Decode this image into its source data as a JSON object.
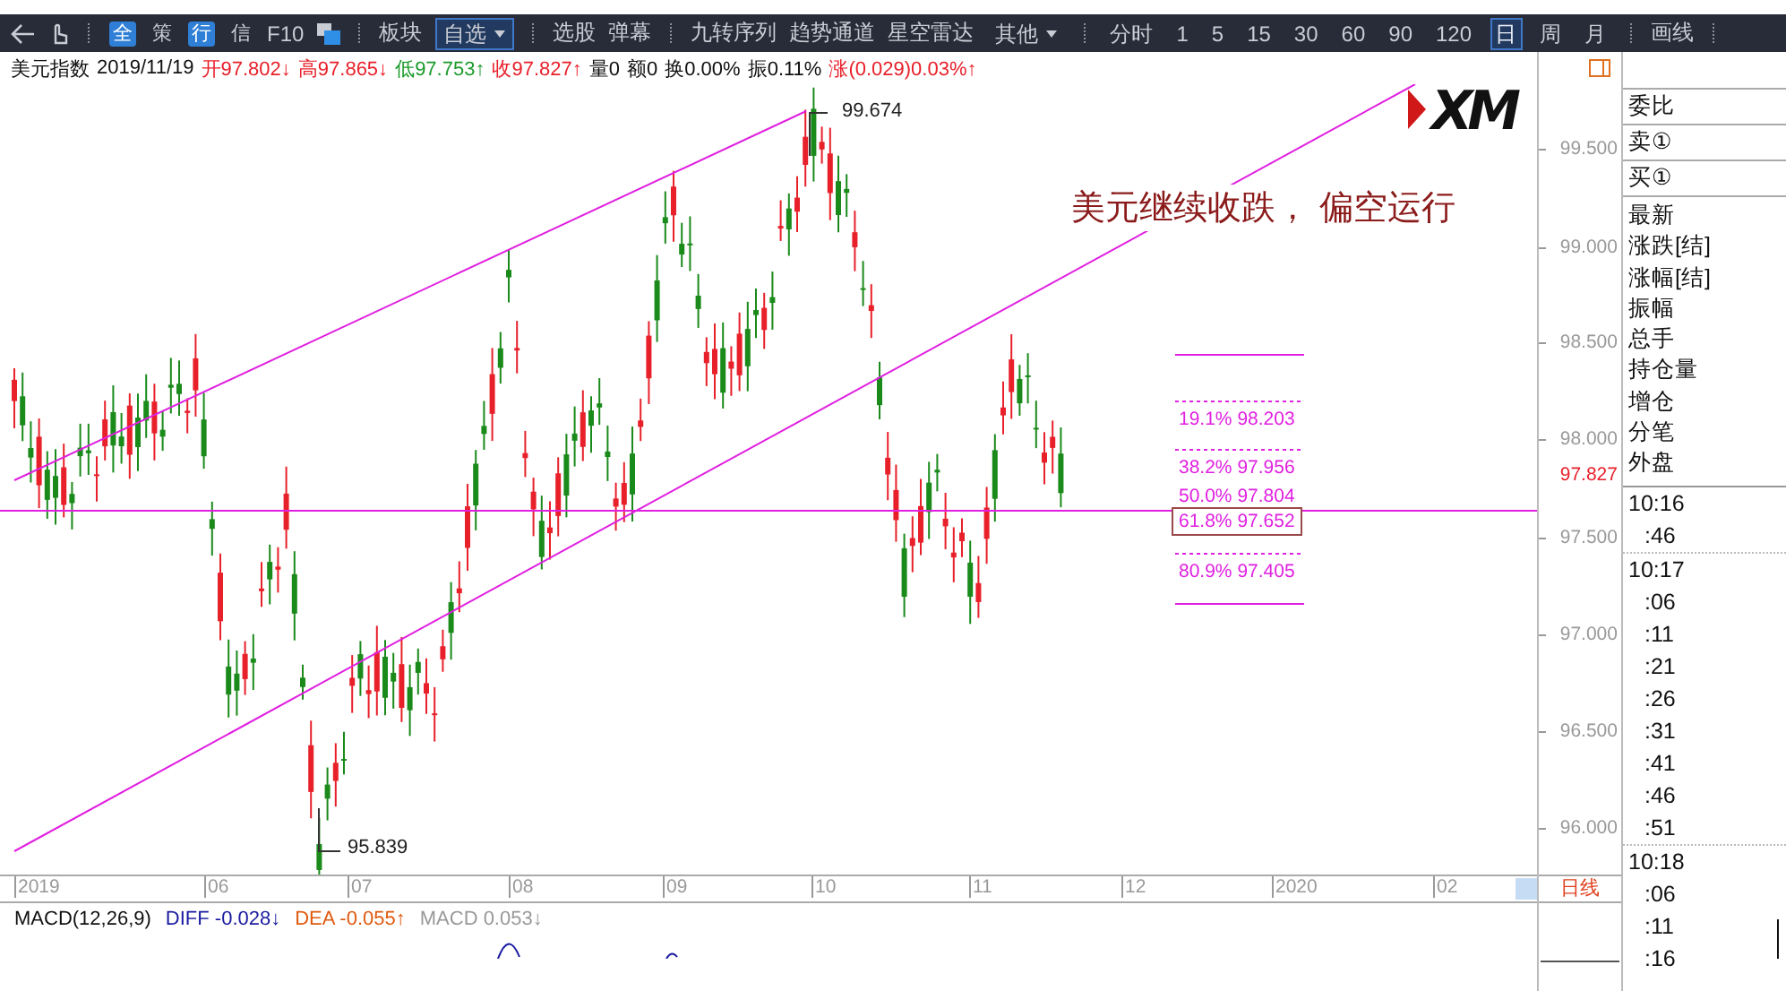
{
  "toolbar": {
    "items": [
      {
        "kind": "icon"
      },
      {
        "kind": "icon"
      },
      {
        "kind": "separator"
      },
      {
        "kind": "badge",
        "label": "全",
        "highlighted": true
      },
      {
        "kind": "badge",
        "label": "策",
        "highlighted": false
      },
      {
        "kind": "badge",
        "label": "行",
        "highlighted": true
      },
      {
        "kind": "badge",
        "label": "信",
        "highlighted": false
      },
      {
        "kind": "text",
        "label": "F10"
      },
      {
        "kind": "icon"
      },
      {
        "kind": "separator"
      },
      {
        "kind": "text",
        "label": "板块"
      },
      {
        "kind": "dropdown",
        "label": "自选",
        "selected": true
      },
      {
        "kind": "separator"
      },
      {
        "kind": "text",
        "label": "选股"
      },
      {
        "kind": "text",
        "label": "弹幕"
      },
      {
        "kind": "separator"
      },
      {
        "kind": "text",
        "label": "九转序列"
      },
      {
        "kind": "text",
        "label": "趋势通道"
      },
      {
        "kind": "text",
        "label": "星空雷达"
      },
      {
        "kind": "dropdown",
        "label": "其他",
        "selected": false
      },
      {
        "kind": "separator"
      },
      {
        "kind": "period",
        "label": "分时",
        "selected": false
      },
      {
        "kind": "period",
        "label": "1",
        "selected": false
      },
      {
        "kind": "period",
        "label": "5",
        "selected": false
      },
      {
        "kind": "period",
        "label": "15",
        "selected": false
      },
      {
        "kind": "period",
        "label": "30",
        "selected": false
      },
      {
        "kind": "period",
        "label": "60",
        "selected": false
      },
      {
        "kind": "period",
        "label": "90",
        "selected": false
      },
      {
        "kind": "period",
        "label": "120",
        "selected": false
      },
      {
        "kind": "period",
        "label": "日",
        "selected": true
      },
      {
        "kind": "period",
        "label": "周",
        "selected": false
      },
      {
        "kind": "period",
        "label": "月",
        "selected": false
      },
      {
        "kind": "separator"
      },
      {
        "kind": "text",
        "label": "画线"
      },
      {
        "kind": "separator"
      }
    ]
  },
  "quote_line": [
    {
      "text": "美元指数",
      "color": "#111111"
    },
    {
      "text": "2019/11/19",
      "color": "#111111"
    },
    {
      "text": "开97.802↓",
      "color": "#e8202a"
    },
    {
      "text": "高97.865↓",
      "color": "#e8202a"
    },
    {
      "text": "低97.753↑",
      "color": "#1a9a2a"
    },
    {
      "text": "收97.827↑",
      "color": "#e8202a"
    },
    {
      "text": "量0",
      "color": "#111111"
    },
    {
      "text": "额0",
      "color": "#111111"
    },
    {
      "text": "换0.00%",
      "color": "#111111"
    },
    {
      "text": "振0.11%",
      "color": "#111111"
    },
    {
      "text": "涨(0.029)0.03%↑",
      "color": "#e8202a"
    }
  ],
  "chart": {
    "logo": "XM",
    "headline": "美元继续收跌， 偏空运行",
    "high_label": "99.674",
    "low_label": "95.839",
    "fib_levels": [
      {
        "label": "19.1% 98.203",
        "boxed": false
      },
      {
        "label": "38.2% 97.956",
        "boxed": false
      },
      {
        "label": "50.0% 97.804",
        "boxed": false
      },
      {
        "label": "61.8% 97.652",
        "boxed": true
      },
      {
        "label": "80.9% 97.405",
        "boxed": false
      }
    ]
  },
  "y_axis": {
    "ticks": [
      "99.500",
      "99.000",
      "98.500",
      "98.000",
      "97.500",
      "97.000",
      "96.500",
      "96.000"
    ],
    "last_price": "97.827"
  },
  "x_axis": {
    "labels": [
      "2019",
      "06",
      "07",
      "08",
      "09",
      "10",
      "11",
      "12",
      "2020",
      "02"
    ],
    "period_label": "日线"
  },
  "macd": {
    "title": "MACD(12,26,9)",
    "diff": "DIFF -0.028↓",
    "dea": "DEA -0.055↑",
    "macd": "MACD 0.053↓"
  },
  "side_panel": {
    "header_rows": [
      "委比",
      "卖①",
      "买①"
    ],
    "fields": [
      "最新",
      "涨跌[结]",
      "涨幅[结]",
      "振幅",
      "总手",
      "持仓量",
      "增仓",
      "分笔",
      "外盘"
    ],
    "ticks": [
      {
        "time": "10:16",
        "seconds": [
          ":46"
        ]
      },
      {
        "time": "10:17",
        "seconds": [
          ":06",
          ":11",
          ":21",
          ":26",
          ":31",
          ":41",
          ":46",
          ":51"
        ]
      },
      {
        "time": "10:18",
        "seconds": [
          ":06",
          ":11",
          ":16"
        ]
      }
    ]
  }
}
